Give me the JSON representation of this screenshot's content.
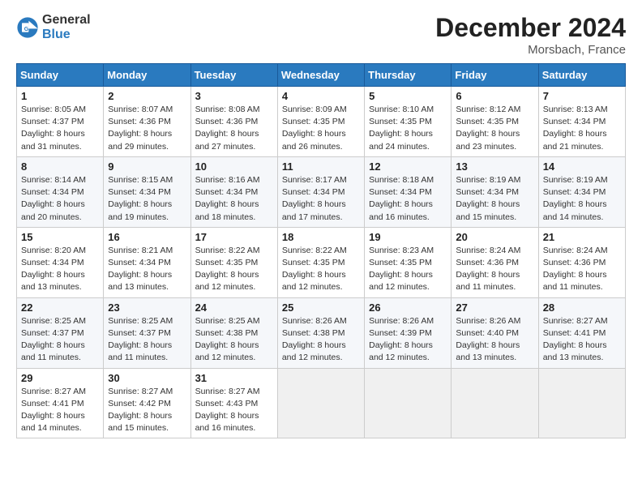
{
  "logo": {
    "line1": "General",
    "line2": "Blue"
  },
  "title": "December 2024",
  "subtitle": "Morsbach, France",
  "days_header": [
    "Sunday",
    "Monday",
    "Tuesday",
    "Wednesday",
    "Thursday",
    "Friday",
    "Saturday"
  ],
  "weeks": [
    [
      {
        "day": "1",
        "sunrise": "8:05 AM",
        "sunset": "4:37 PM",
        "daylight": "8 hours and 31 minutes."
      },
      {
        "day": "2",
        "sunrise": "8:07 AM",
        "sunset": "4:36 PM",
        "daylight": "8 hours and 29 minutes."
      },
      {
        "day": "3",
        "sunrise": "8:08 AM",
        "sunset": "4:36 PM",
        "daylight": "8 hours and 27 minutes."
      },
      {
        "day": "4",
        "sunrise": "8:09 AM",
        "sunset": "4:35 PM",
        "daylight": "8 hours and 26 minutes."
      },
      {
        "day": "5",
        "sunrise": "8:10 AM",
        "sunset": "4:35 PM",
        "daylight": "8 hours and 24 minutes."
      },
      {
        "day": "6",
        "sunrise": "8:12 AM",
        "sunset": "4:35 PM",
        "daylight": "8 hours and 23 minutes."
      },
      {
        "day": "7",
        "sunrise": "8:13 AM",
        "sunset": "4:34 PM",
        "daylight": "8 hours and 21 minutes."
      }
    ],
    [
      {
        "day": "8",
        "sunrise": "8:14 AM",
        "sunset": "4:34 PM",
        "daylight": "8 hours and 20 minutes."
      },
      {
        "day": "9",
        "sunrise": "8:15 AM",
        "sunset": "4:34 PM",
        "daylight": "8 hours and 19 minutes."
      },
      {
        "day": "10",
        "sunrise": "8:16 AM",
        "sunset": "4:34 PM",
        "daylight": "8 hours and 18 minutes."
      },
      {
        "day": "11",
        "sunrise": "8:17 AM",
        "sunset": "4:34 PM",
        "daylight": "8 hours and 17 minutes."
      },
      {
        "day": "12",
        "sunrise": "8:18 AM",
        "sunset": "4:34 PM",
        "daylight": "8 hours and 16 minutes."
      },
      {
        "day": "13",
        "sunrise": "8:19 AM",
        "sunset": "4:34 PM",
        "daylight": "8 hours and 15 minutes."
      },
      {
        "day": "14",
        "sunrise": "8:19 AM",
        "sunset": "4:34 PM",
        "daylight": "8 hours and 14 minutes."
      }
    ],
    [
      {
        "day": "15",
        "sunrise": "8:20 AM",
        "sunset": "4:34 PM",
        "daylight": "8 hours and 13 minutes."
      },
      {
        "day": "16",
        "sunrise": "8:21 AM",
        "sunset": "4:34 PM",
        "daylight": "8 hours and 13 minutes."
      },
      {
        "day": "17",
        "sunrise": "8:22 AM",
        "sunset": "4:35 PM",
        "daylight": "8 hours and 12 minutes."
      },
      {
        "day": "18",
        "sunrise": "8:22 AM",
        "sunset": "4:35 PM",
        "daylight": "8 hours and 12 minutes."
      },
      {
        "day": "19",
        "sunrise": "8:23 AM",
        "sunset": "4:35 PM",
        "daylight": "8 hours and 12 minutes."
      },
      {
        "day": "20",
        "sunrise": "8:24 AM",
        "sunset": "4:36 PM",
        "daylight": "8 hours and 11 minutes."
      },
      {
        "day": "21",
        "sunrise": "8:24 AM",
        "sunset": "4:36 PM",
        "daylight": "8 hours and 11 minutes."
      }
    ],
    [
      {
        "day": "22",
        "sunrise": "8:25 AM",
        "sunset": "4:37 PM",
        "daylight": "8 hours and 11 minutes."
      },
      {
        "day": "23",
        "sunrise": "8:25 AM",
        "sunset": "4:37 PM",
        "daylight": "8 hours and 11 minutes."
      },
      {
        "day": "24",
        "sunrise": "8:25 AM",
        "sunset": "4:38 PM",
        "daylight": "8 hours and 12 minutes."
      },
      {
        "day": "25",
        "sunrise": "8:26 AM",
        "sunset": "4:38 PM",
        "daylight": "8 hours and 12 minutes."
      },
      {
        "day": "26",
        "sunrise": "8:26 AM",
        "sunset": "4:39 PM",
        "daylight": "8 hours and 12 minutes."
      },
      {
        "day": "27",
        "sunrise": "8:26 AM",
        "sunset": "4:40 PM",
        "daylight": "8 hours and 13 minutes."
      },
      {
        "day": "28",
        "sunrise": "8:27 AM",
        "sunset": "4:41 PM",
        "daylight": "8 hours and 13 minutes."
      }
    ],
    [
      {
        "day": "29",
        "sunrise": "8:27 AM",
        "sunset": "4:41 PM",
        "daylight": "8 hours and 14 minutes."
      },
      {
        "day": "30",
        "sunrise": "8:27 AM",
        "sunset": "4:42 PM",
        "daylight": "8 hours and 15 minutes."
      },
      {
        "day": "31",
        "sunrise": "8:27 AM",
        "sunset": "4:43 PM",
        "daylight": "8 hours and 16 minutes."
      },
      null,
      null,
      null,
      null
    ]
  ],
  "labels": {
    "sunrise": "Sunrise:",
    "sunset": "Sunset:",
    "daylight": "Daylight:"
  }
}
